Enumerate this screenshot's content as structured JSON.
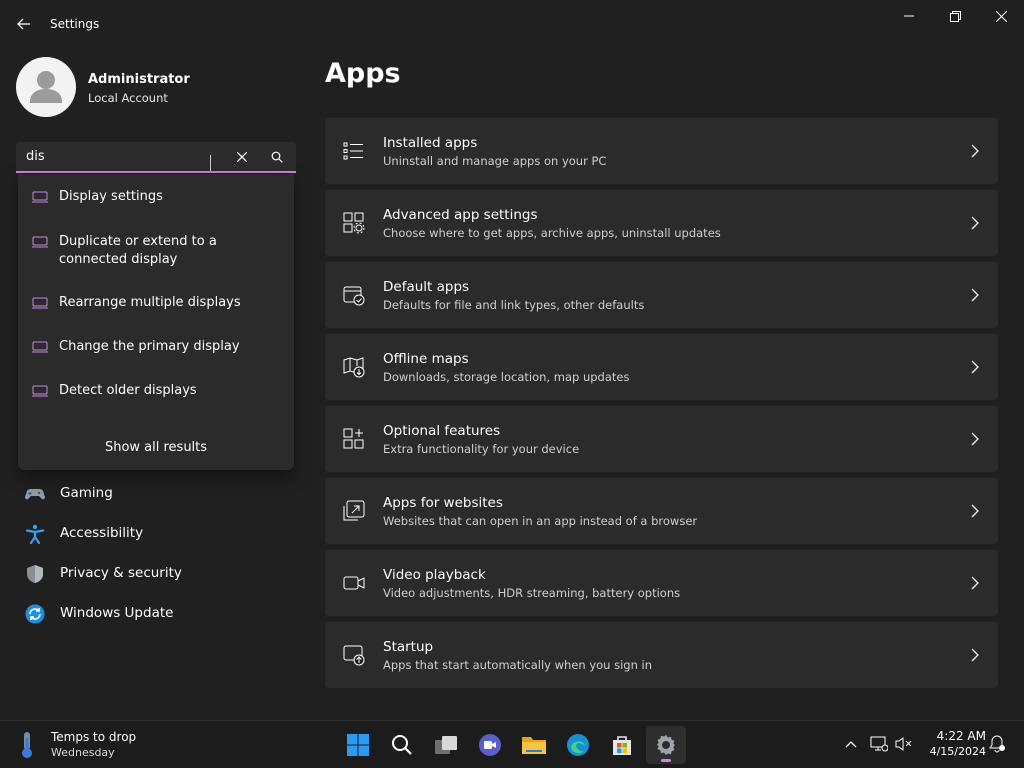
{
  "window": {
    "title": "Settings"
  },
  "profile": {
    "name": "Administrator",
    "account_type": "Local Account"
  },
  "search": {
    "value": "dis",
    "suggestions": [
      {
        "label": "Display settings"
      },
      {
        "label": "Duplicate or extend to a connected display"
      },
      {
        "label": "Rearrange multiple displays"
      },
      {
        "label": "Change the primary display"
      },
      {
        "label": "Detect older displays"
      }
    ],
    "show_all_label": "Show all results"
  },
  "nav": {
    "items": [
      {
        "label": "Gaming",
        "icon": "gamepad-icon"
      },
      {
        "label": "Accessibility",
        "icon": "accessibility-icon"
      },
      {
        "label": "Privacy & security",
        "icon": "shield-icon"
      },
      {
        "label": "Windows Update",
        "icon": "windows-update-icon"
      }
    ]
  },
  "main": {
    "title": "Apps",
    "cards": [
      {
        "title": "Installed apps",
        "subtitle": "Uninstall and manage apps on your PC",
        "icon": "list-icon"
      },
      {
        "title": "Advanced app settings",
        "subtitle": "Choose where to get apps, archive apps, uninstall updates",
        "icon": "app-settings-icon"
      },
      {
        "title": "Default apps",
        "subtitle": "Defaults for file and link types, other defaults",
        "icon": "default-apps-icon"
      },
      {
        "title": "Offline maps",
        "subtitle": "Downloads, storage location, map updates",
        "icon": "map-icon"
      },
      {
        "title": "Optional features",
        "subtitle": "Extra functionality for your device",
        "icon": "add-features-icon"
      },
      {
        "title": "Apps for websites",
        "subtitle": "Websites that can open in an app instead of a browser",
        "icon": "open-in-app-icon"
      },
      {
        "title": "Video playback",
        "subtitle": "Video adjustments, HDR streaming, battery options",
        "icon": "video-icon"
      },
      {
        "title": "Startup",
        "subtitle": "Apps that start automatically when you sign in",
        "icon": "startup-icon"
      }
    ]
  },
  "taskbar": {
    "weather_title": "Temps to drop",
    "weather_subtitle": "Wednesday",
    "time": "4:22 AM",
    "date": "4/15/2024"
  },
  "colors": {
    "accent": "#c987e0",
    "background": "#202020",
    "card": "#2b2b2b"
  }
}
